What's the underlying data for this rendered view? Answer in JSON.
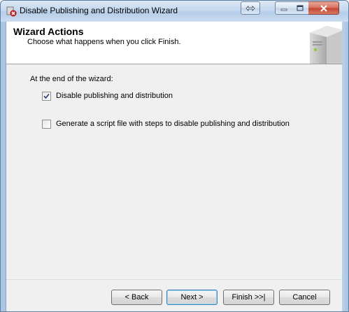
{
  "window": {
    "title": "Disable Publishing and Distribution Wizard",
    "controls": {
      "restore_icon": "double-arrow-icon",
      "minimize_icon": "minimize-icon",
      "maximize_icon": "maximize-icon",
      "close_icon": "close-icon"
    }
  },
  "header": {
    "title": "Wizard Actions",
    "subtitle": "Choose what happens when you click Finish."
  },
  "body": {
    "section_label": "At the end of the wizard:",
    "options": [
      {
        "label": "Disable publishing and distribution",
        "checked": true
      },
      {
        "label": "Generate a script file with steps to disable publishing and distribution",
        "checked": false
      }
    ]
  },
  "footer": {
    "back_label": "< Back",
    "next_label": "Next >",
    "finish_label": "Finish >>|",
    "cancel_label": "Cancel"
  }
}
